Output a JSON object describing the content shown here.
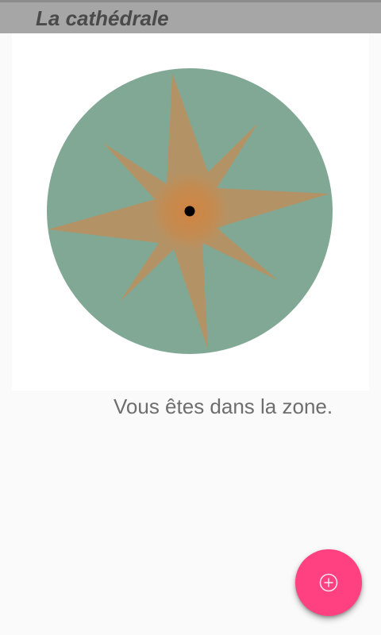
{
  "app_bar": {
    "title": "La cathédrale"
  },
  "zone_map": {
    "zone_color": "#81a895",
    "star_color": "#c28d58",
    "center_glow_color": "#d2843f",
    "position_marker_color": "#000000"
  },
  "status": {
    "message": "Vous êtes dans la zone."
  },
  "fab": {
    "icon": "add-circle-icon",
    "color": "#ff4081"
  },
  "colors": {
    "app_bar": "#a6a6a6",
    "background": "#fafafa",
    "title_text": "#4a4a4a",
    "status_text": "#6e6e6e"
  }
}
